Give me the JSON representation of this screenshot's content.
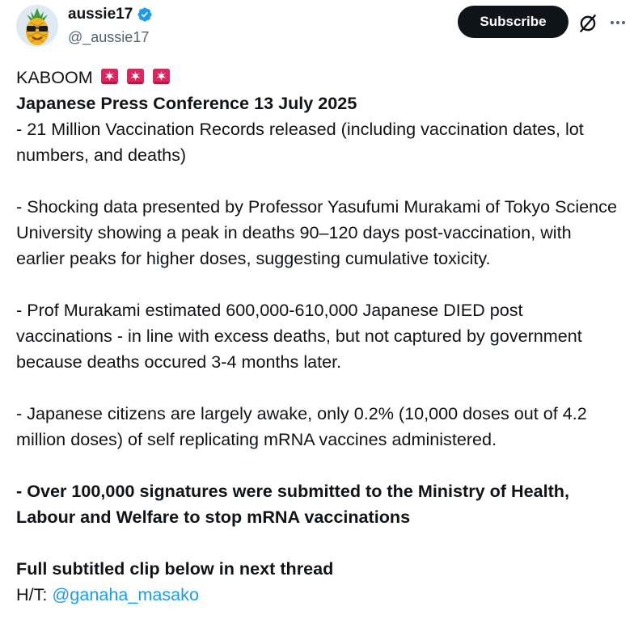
{
  "author": {
    "name": "aussie17",
    "handle": "@_aussie17",
    "verified_icon": "verified-badge-icon",
    "avatar_icon": "pineapple-avatar-icon"
  },
  "actions": {
    "subscribe_label": "Subscribe",
    "grok_icon": "grok-icon",
    "more_icon": "more-options-icon"
  },
  "post": {
    "line1": "KABOOM",
    "line1_emoji_icon": "rotating-light-icon",
    "title": "Japanese Press Conference 13 July 2025",
    "para1": "- 21 Million Vaccination Records released (including vaccination dates, lot numbers, and deaths)",
    "para2": "- Shocking data presented by Professor Yasufumi Murakami of Tokyo Science University showing a peak in deaths 90–120 days post-vaccination, with earlier peaks for higher doses, suggesting cumulative toxicity.",
    "para3": "- Prof Murakami estimated 600,000-610,000 Japanese DIED post vaccinations - in line with excess deaths, but not captured by government because deaths occured 3-4 months later.",
    "para4": "- Japanese citizens are largely awake, only 0.2% (10,000 doses out of 4.2 million doses) of self replicating mRNA vaccines administered.",
    "para5": "- Over 100,000 signatures were submitted to the Ministry of Health, Labour and Welfare to stop mRNA vaccinations",
    "para6": "Full subtitled clip below in next thread",
    "ht_prefix": "H/T: ",
    "ht_mention": "@ganaha_masako"
  },
  "colors": {
    "text": "#0f1419",
    "secondary": "#536471",
    "link": "#1d9bf0",
    "button_bg": "#0f1419",
    "verified": "#1d9bf0",
    "siren": "#e0245e"
  }
}
